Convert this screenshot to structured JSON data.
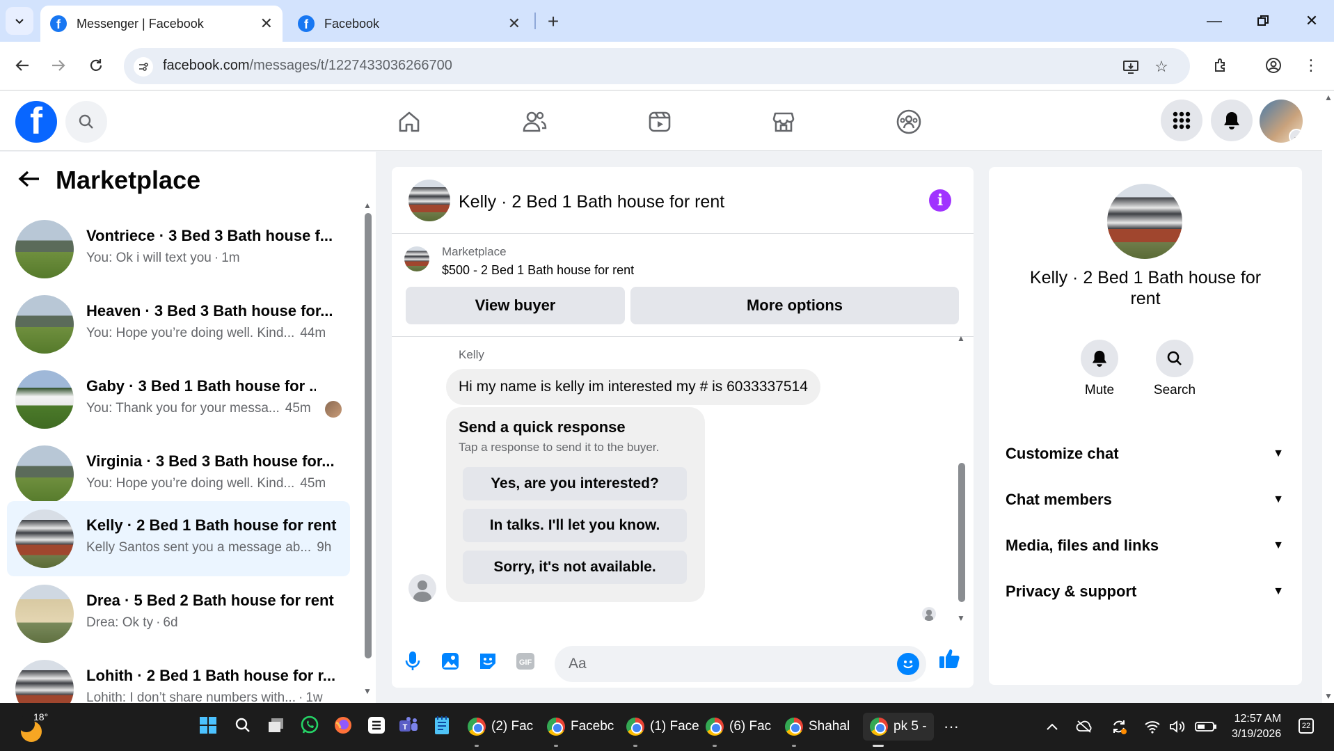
{
  "browser": {
    "tabs": [
      {
        "title": "Messenger | Facebook",
        "active": true
      },
      {
        "title": "Facebook",
        "active": false
      }
    ],
    "url_domain": "facebook.com",
    "url_path": "/messages/t/1227433036266700"
  },
  "sidebar": {
    "title": "Marketplace",
    "chats": [
      {
        "name": "Vontriece · 3 Bed 3 Bath house f...",
        "snippet": "You: Ok i will text you",
        "time": "1m",
        "thumb": "house"
      },
      {
        "name": "Heaven · 3 Bed 3 Bath house for...",
        "snippet": "You: Hope you’re doing well. Kind...",
        "time": "44m",
        "thumb": "house"
      },
      {
        "name": "Gaby · 3 Bed 1 Bath house for ...",
        "snippet": "You: Thank you for your messa...",
        "time": "45m",
        "thumb": "white-house"
      },
      {
        "name": "Virginia · 3 Bed 3 Bath house for...",
        "snippet": "You: Hope you’re doing well. Kind...",
        "time": "45m",
        "thumb": "house"
      },
      {
        "name": "Kelly · 2 Bed 1 Bath house for rent",
        "snippet": "Kelly Santos sent you a message ab...",
        "time": "9h",
        "thumb": "apartment",
        "selected": true
      },
      {
        "name": "Drea · 5 Bed 2 Bath house for rent",
        "snippet": "Drea: Ok ty",
        "time": "6d",
        "thumb": "tan-house"
      },
      {
        "name": "Lohith · 2 Bed 1 Bath house for r...",
        "snippet": "Lohith: I don’t share numbers with...",
        "time": "1w",
        "thumb": "apartment"
      }
    ]
  },
  "conversation": {
    "title": "Kelly · 2 Bed 1 Bath house for rent",
    "listing_source": "Marketplace",
    "listing_title": "$500 - 2 Bed 1 Bath house for rent",
    "view_buyer_label": "View buyer",
    "more_options_label": "More options",
    "sender_name": "Kelly",
    "message": "Hi my name is kelly im interested my # is 6033337514",
    "quick_title": "Send a quick response",
    "quick_sub": "Tap a response to send it to the buyer.",
    "quick_replies": [
      "Yes, are you interested?",
      "In talks. I'll let you know.",
      "Sorry, it's not available."
    ],
    "composer_placeholder": "Aa"
  },
  "details": {
    "name": "Kelly · 2 Bed 1 Bath house for rent",
    "mute_label": "Mute",
    "search_label": "Search",
    "sections": [
      "Customize chat",
      "Chat members",
      "Media, files and links",
      "Privacy & support"
    ]
  },
  "taskbar": {
    "temperature": "18°",
    "windows": [
      "(2) Fac",
      "Facebc",
      "(1) Face",
      "(6) Fac",
      "Shahal",
      "pk 5 -"
    ],
    "more": "···",
    "time": "12:57 AM",
    "date": "3/19/2026",
    "notifications": "22"
  },
  "colors": {
    "facebook_blue": "#0866ff",
    "messenger_blue": "#0084ff",
    "info_purple": "#a033ff",
    "selected_row": "#ebf5ff"
  }
}
